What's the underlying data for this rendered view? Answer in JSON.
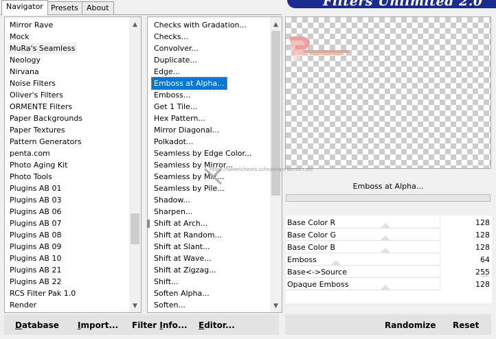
{
  "tabs": [
    "Navigator",
    "Presets",
    "About"
  ],
  "banner_title": "Filters Unlimited 2.0",
  "categories": [
    "Mirror Rave",
    "Mock",
    "MuRa's Seamless",
    "Neology",
    "Nirvana",
    "Noise Filters",
    "Oliver's Filters",
    "ORMENTE Filters",
    "Paper Backgrounds",
    "Paper Textures",
    "Pattern Generators",
    "penta.com",
    "Photo Aging Kit",
    "Photo Tools",
    "Plugins AB 01",
    "Plugins AB 03",
    "Plugins AB 06",
    "Plugins AB 07",
    "Plugins AB 08",
    "Plugins AB 09",
    "Plugins AB 10",
    "Plugins AB 21",
    "Plugins AB 22",
    "RCS Filter Pak 1.0",
    "Render"
  ],
  "selected_category": "MuRa's Seamless",
  "filters": [
    "Checks with Gradation...",
    "Checks...",
    "Convolver...",
    "Duplicate...",
    "Edge...",
    "Emboss at Alpha...",
    "Emboss...",
    "Get 1 Tile...",
    "Hex Pattern...",
    "Mirror Diagonal...",
    "Polkadot...",
    "Seamless by Edge Color...",
    "Seamless by Mirror...",
    "Seamless by Mix...",
    "Seamless by Pile...",
    "Shadow...",
    "Sharpen...",
    "Shift at Arch...",
    "Shift at Random...",
    "Shift at Slant...",
    "Shift at Wave...",
    "Shift at Zigzag...",
    "Shift...",
    "Soften Alpha...",
    "Soften..."
  ],
  "selected_filter": "Emboss at Alpha...",
  "filter_title": "Emboss at Alpha...",
  "progress": 0,
  "parameters": [
    {
      "label": "Base Color R",
      "value": "128",
      "level": 0.5
    },
    {
      "label": "Base Color G",
      "value": "128",
      "level": 0.5
    },
    {
      "label": "Base Color B",
      "value": "128",
      "level": 0.5
    },
    {
      "label": "Emboss",
      "value": "64",
      "level": 0.25
    },
    {
      "label": "Base<->Source",
      "value": "255",
      "level": 1.0
    },
    {
      "label": "Opaque Emboss",
      "value": "128",
      "level": 0.5
    }
  ],
  "buttons": {
    "database": {
      "mnemonic": "D",
      "rest": "atabase"
    },
    "import": {
      "mnemonic": "I",
      "rest": "mport..."
    },
    "filter_info": {
      "pre": "Filter ",
      "mnemonic": "I",
      "rest": "nfo..."
    },
    "editor": {
      "mnemonic": "E",
      "rest": "ditor..."
    },
    "randomize": "Randomize",
    "reset": "Reset"
  },
  "watermark": "https://sweetcheats.schnaibigerwerken.de/",
  "colors": {
    "selection": "#0078d7",
    "banner": "#1c2b8f",
    "progress": "#06b025"
  }
}
